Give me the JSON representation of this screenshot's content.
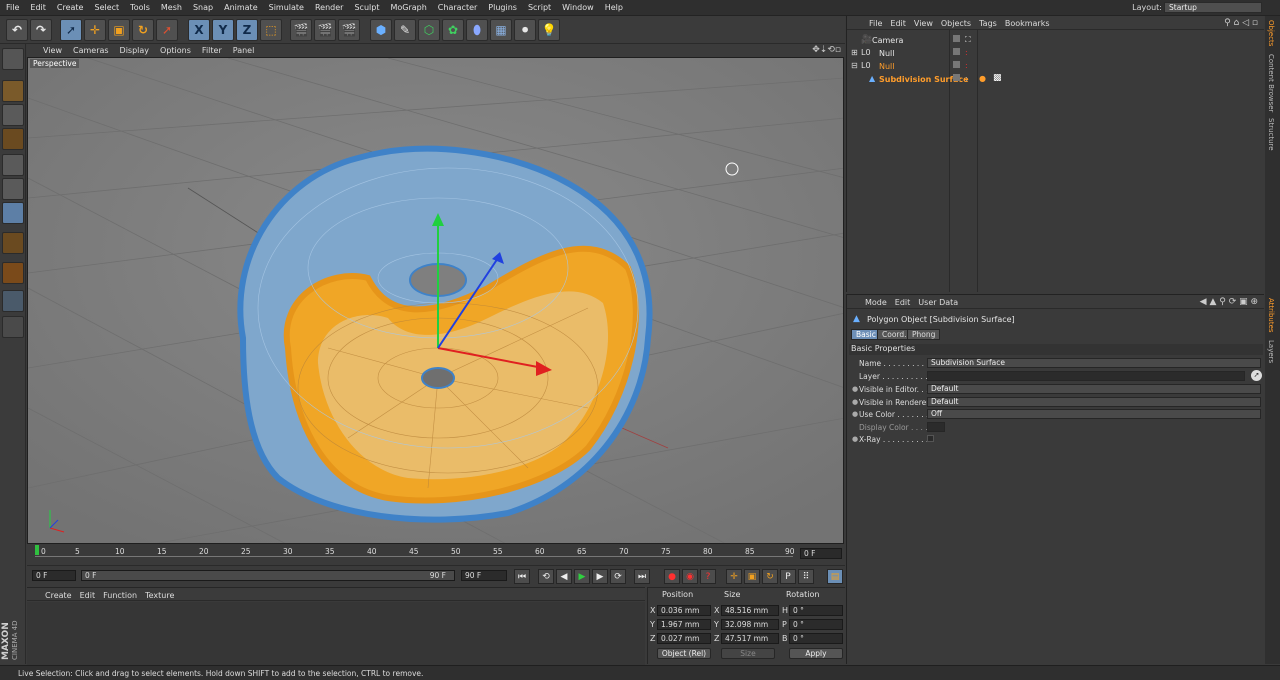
{
  "menubar": {
    "items": [
      "File",
      "Edit",
      "Create",
      "Select",
      "Tools",
      "Mesh",
      "Snap",
      "Animate",
      "Simulate",
      "Render",
      "Sculpt",
      "MoGraph",
      "Character",
      "Plugins",
      "Script",
      "Window",
      "Help"
    ],
    "layout_label": "Layout:",
    "layout_value": "Startup"
  },
  "toolbar": {
    "axis_x": "X",
    "axis_y": "Y",
    "axis_z": "Z"
  },
  "viewport": {
    "menu": [
      "View",
      "Cameras",
      "Display",
      "Options",
      "Filter",
      "Panel"
    ],
    "label": "Perspective"
  },
  "timeline": {
    "ticks": [
      "0",
      "5",
      "10",
      "15",
      "20",
      "25",
      "30",
      "35",
      "40",
      "45",
      "50",
      "55",
      "60",
      "65",
      "70",
      "75",
      "80",
      "85",
      "90"
    ],
    "current_frame": "0 F"
  },
  "transport": {
    "start": "0 F",
    "range_start": "0 F",
    "range_end": "90 F",
    "end": "90 F"
  },
  "material_manager": {
    "menu": [
      "Create",
      "Edit",
      "Function",
      "Texture"
    ]
  },
  "branding": {
    "maxon": "MAXON",
    "product": "CINEMA 4D"
  },
  "coordinates": {
    "headers": {
      "position": "Position",
      "size": "Size",
      "rotation": "Rotation"
    },
    "rows": [
      {
        "axis": "X",
        "pos": "0.036 mm",
        "size_axis": "X",
        "size": "48.516 mm",
        "rot_axis": "H",
        "rot": "0 °"
      },
      {
        "axis": "Y",
        "pos": "1.967 mm",
        "size_axis": "Y",
        "size": "32.098 mm",
        "rot_axis": "P",
        "rot": "0 °"
      },
      {
        "axis": "Z",
        "pos": "0.027 mm",
        "size_axis": "Z",
        "size": "47.517 mm",
        "rot_axis": "B",
        "rot": "0 °"
      }
    ],
    "mode": "Object (Rel)",
    "size_mode": "Size",
    "apply": "Apply"
  },
  "object_manager": {
    "menu": [
      "File",
      "Edit",
      "View",
      "Objects",
      "Tags",
      "Bookmarks"
    ],
    "objects": [
      {
        "name": "Camera",
        "selected": false
      },
      {
        "name": "Null",
        "selected": false
      },
      {
        "name": "Null",
        "selected": true
      },
      {
        "name": "Subdivision Surface",
        "selected": true
      }
    ]
  },
  "attribute_manager": {
    "menu": [
      "Mode",
      "Edit",
      "User Data"
    ],
    "title": "Polygon Object [Subdivision Surface]",
    "tabs": [
      "Basic",
      "Coord.",
      "Phong"
    ],
    "section": "Basic Properties",
    "rows": [
      {
        "label": "Name . . . . . . . . . .",
        "value": "Subdivision Surface"
      },
      {
        "label": "Layer . . . . . . . . . .",
        "value": ""
      },
      {
        "label": "Visible in Editor. . .",
        "value": "Default"
      },
      {
        "label": "Visible in Renderer",
        "value": "Default"
      },
      {
        "label": "Use Color . . . . . . .",
        "value": "Off"
      },
      {
        "label": "Display Color . . . .",
        "value": ""
      },
      {
        "label": "X-Ray . . . . . . . . . .",
        "value": ""
      }
    ]
  },
  "side_tabs": [
    "Objects",
    "Content Browser",
    "Structure",
    "Attributes",
    "Layers"
  ],
  "status": "Live Selection: Click and drag to select elements. Hold down SHIFT to add to the selection, CTRL to remove.",
  "colors": {
    "accent": "#ff9d2b",
    "selection_blue": "#5d7fa6",
    "wire_blue": "#4a8fd0",
    "wire_orange": "#f4a91c"
  }
}
